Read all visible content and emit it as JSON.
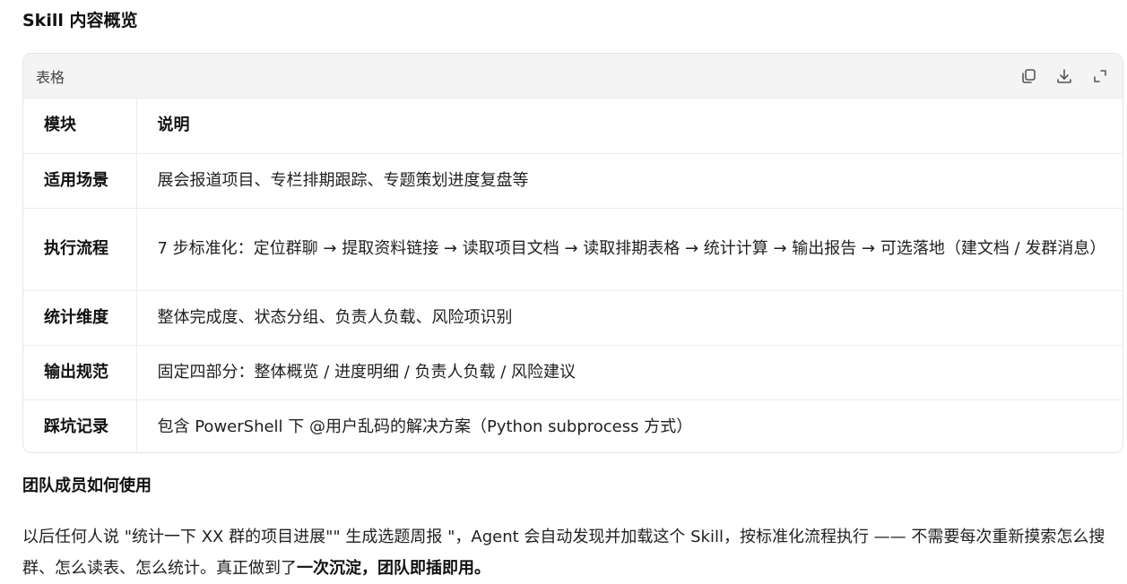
{
  "heading": "Skill 内容概览",
  "table_card": {
    "label": "表格",
    "icons": [
      "copy-icon",
      "download-icon",
      "expand-icon"
    ],
    "header": {
      "col1": "模块",
      "col2": "说明"
    },
    "rows": [
      {
        "module": "适用场景",
        "desc": "展会报道项目、专栏排期跟踪、专题策划进度复盘等"
      },
      {
        "module": "执行流程",
        "desc": "7 步标准化：定位群聊 → 提取资料链接 → 读取项目文档 → 读取排期表格 → 统计计算 → 输出报告 → 可选落地（建文档 / 发群消息）"
      },
      {
        "module": "统计维度",
        "desc": "整体完成度、状态分组、负责人负载、风险项识别"
      },
      {
        "module": "输出规范",
        "desc": "固定四部分：整体概览 / 进度明细 / 负责人负载 / 风险建议"
      },
      {
        "module": "踩坑记录",
        "desc": "包含 PowerShell 下 @用户乱码的解决方案（Python subprocess 方式）"
      }
    ]
  },
  "usage": {
    "heading": "团队成员如何使用",
    "text": "以后任何人说 \"统计一下 XX 群的项目进展\"\" 生成选题周报 \"，Agent 会自动发现并加载这个 Skill，按标准化流程执行 —— 不需要每次重新摸索怎么搜群、怎么读表、怎么统计。真正做到了",
    "emphasis": "一次沉淀，团队即插即用。"
  }
}
